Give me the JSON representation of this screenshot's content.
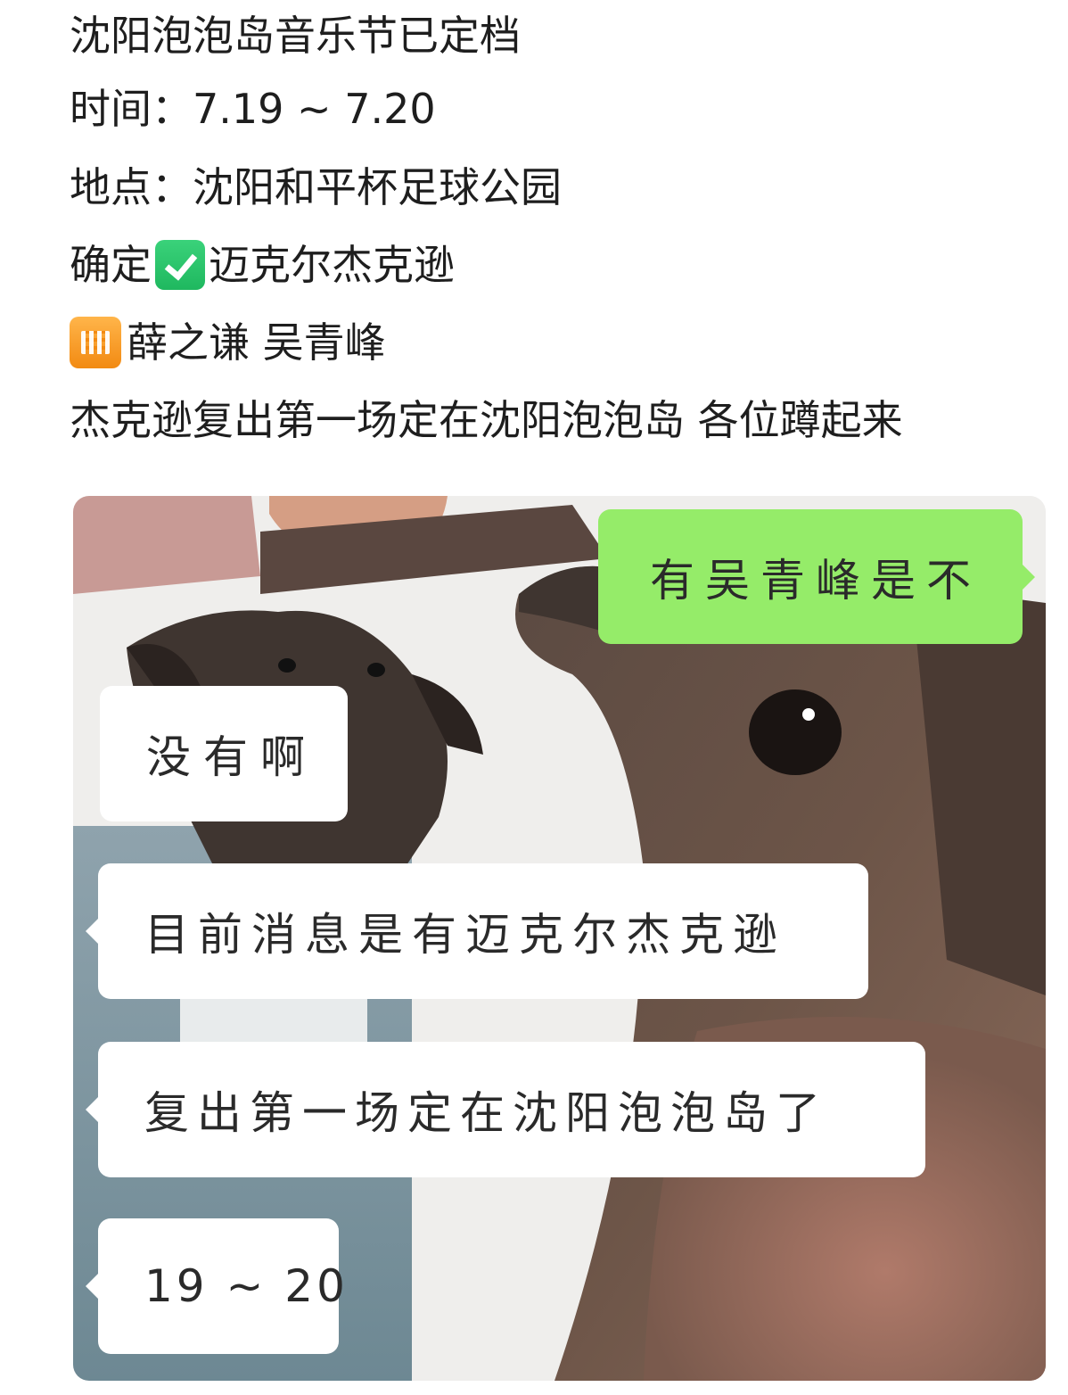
{
  "post": {
    "line1": "沈阳泡泡岛音乐节已定档",
    "line2": "时间：7.19 ~ 7.20",
    "line3": "地点：沈阳和平杯足球公园",
    "line4_prefix": "确定",
    "line4_name": "迈克尔杰克逊",
    "line5_names": "薛之谦 吴青峰",
    "line6": "杰克逊复出第一场定在沈阳泡泡岛 各位蹲起来",
    "icons": {
      "confirmed": "check-mark-emoji",
      "pending": "busy-vacancy-emoji"
    }
  },
  "meme": {
    "subject": "two dogs chat meme",
    "messages": [
      {
        "side": "right",
        "text": "有吴青峰是不"
      },
      {
        "side": "left",
        "text": "没有啊"
      },
      {
        "side": "left",
        "text": "目前消息是有迈克尔杰克逊"
      },
      {
        "side": "left",
        "text": "复出第一场定在沈阳泡泡岛了"
      },
      {
        "side": "left",
        "text": "19 ~ 20"
      }
    ],
    "colors": {
      "my_bubble": "#95ec69",
      "their_bubble": "#ffffff"
    }
  }
}
